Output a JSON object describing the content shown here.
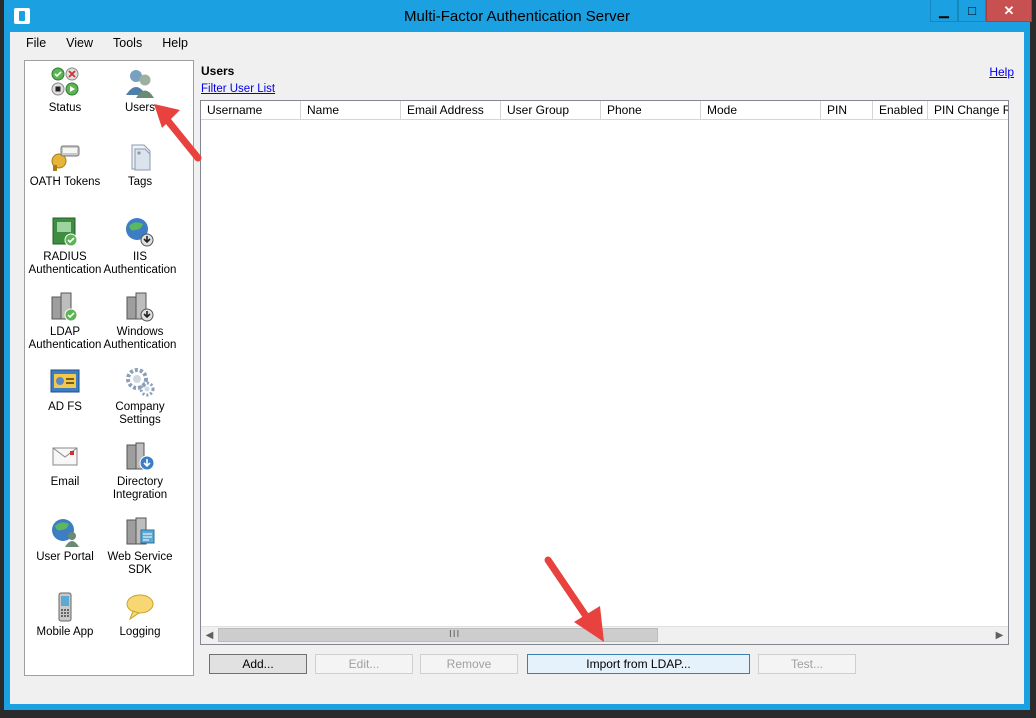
{
  "window": {
    "title": "Multi-Factor Authentication Server",
    "minimize": "▁",
    "maximize": "□",
    "close": "✕"
  },
  "menu": [
    "File",
    "View",
    "Tools",
    "Help"
  ],
  "nav": [
    {
      "label": "Status",
      "icon": "status-icon"
    },
    {
      "label": "Users",
      "icon": "users-icon"
    },
    {
      "label": "OATH Tokens",
      "icon": "oath-tokens-icon"
    },
    {
      "label": "Tags",
      "icon": "tags-icon"
    },
    {
      "label": "RADIUS\nAuthentication",
      "icon": "radius-icon"
    },
    {
      "label": "IIS\nAuthentication",
      "icon": "iis-icon"
    },
    {
      "label": "LDAP\nAuthentication",
      "icon": "ldap-icon"
    },
    {
      "label": "Windows\nAuthentication",
      "icon": "windows-auth-icon"
    },
    {
      "label": "AD FS",
      "icon": "adfs-icon"
    },
    {
      "label": "Company\nSettings",
      "icon": "company-settings-icon"
    },
    {
      "label": "Email",
      "icon": "email-icon"
    },
    {
      "label": "Directory\nIntegration",
      "icon": "directory-integration-icon"
    },
    {
      "label": "User Portal",
      "icon": "user-portal-icon"
    },
    {
      "label": "Web Service\nSDK",
      "icon": "web-service-sdk-icon"
    },
    {
      "label": "Mobile App",
      "icon": "mobile-app-icon"
    },
    {
      "label": "Logging",
      "icon": "logging-icon"
    }
  ],
  "content": {
    "title": "Users",
    "help": "Help",
    "filter": "Filter User List",
    "columns": [
      "Username",
      "Name",
      "Email Address",
      "User Group",
      "Phone",
      "Mode",
      "PIN",
      "Enabled",
      "PIN Change Re"
    ],
    "scroll_grip": "III"
  },
  "buttons": {
    "add": "Add...",
    "edit": "Edit...",
    "remove": "Remove",
    "import": "Import from LDAP...",
    "test": "Test..."
  },
  "colors": {
    "titlebar": "#1ba1e2",
    "annotation_arrow": "#e8423f"
  }
}
